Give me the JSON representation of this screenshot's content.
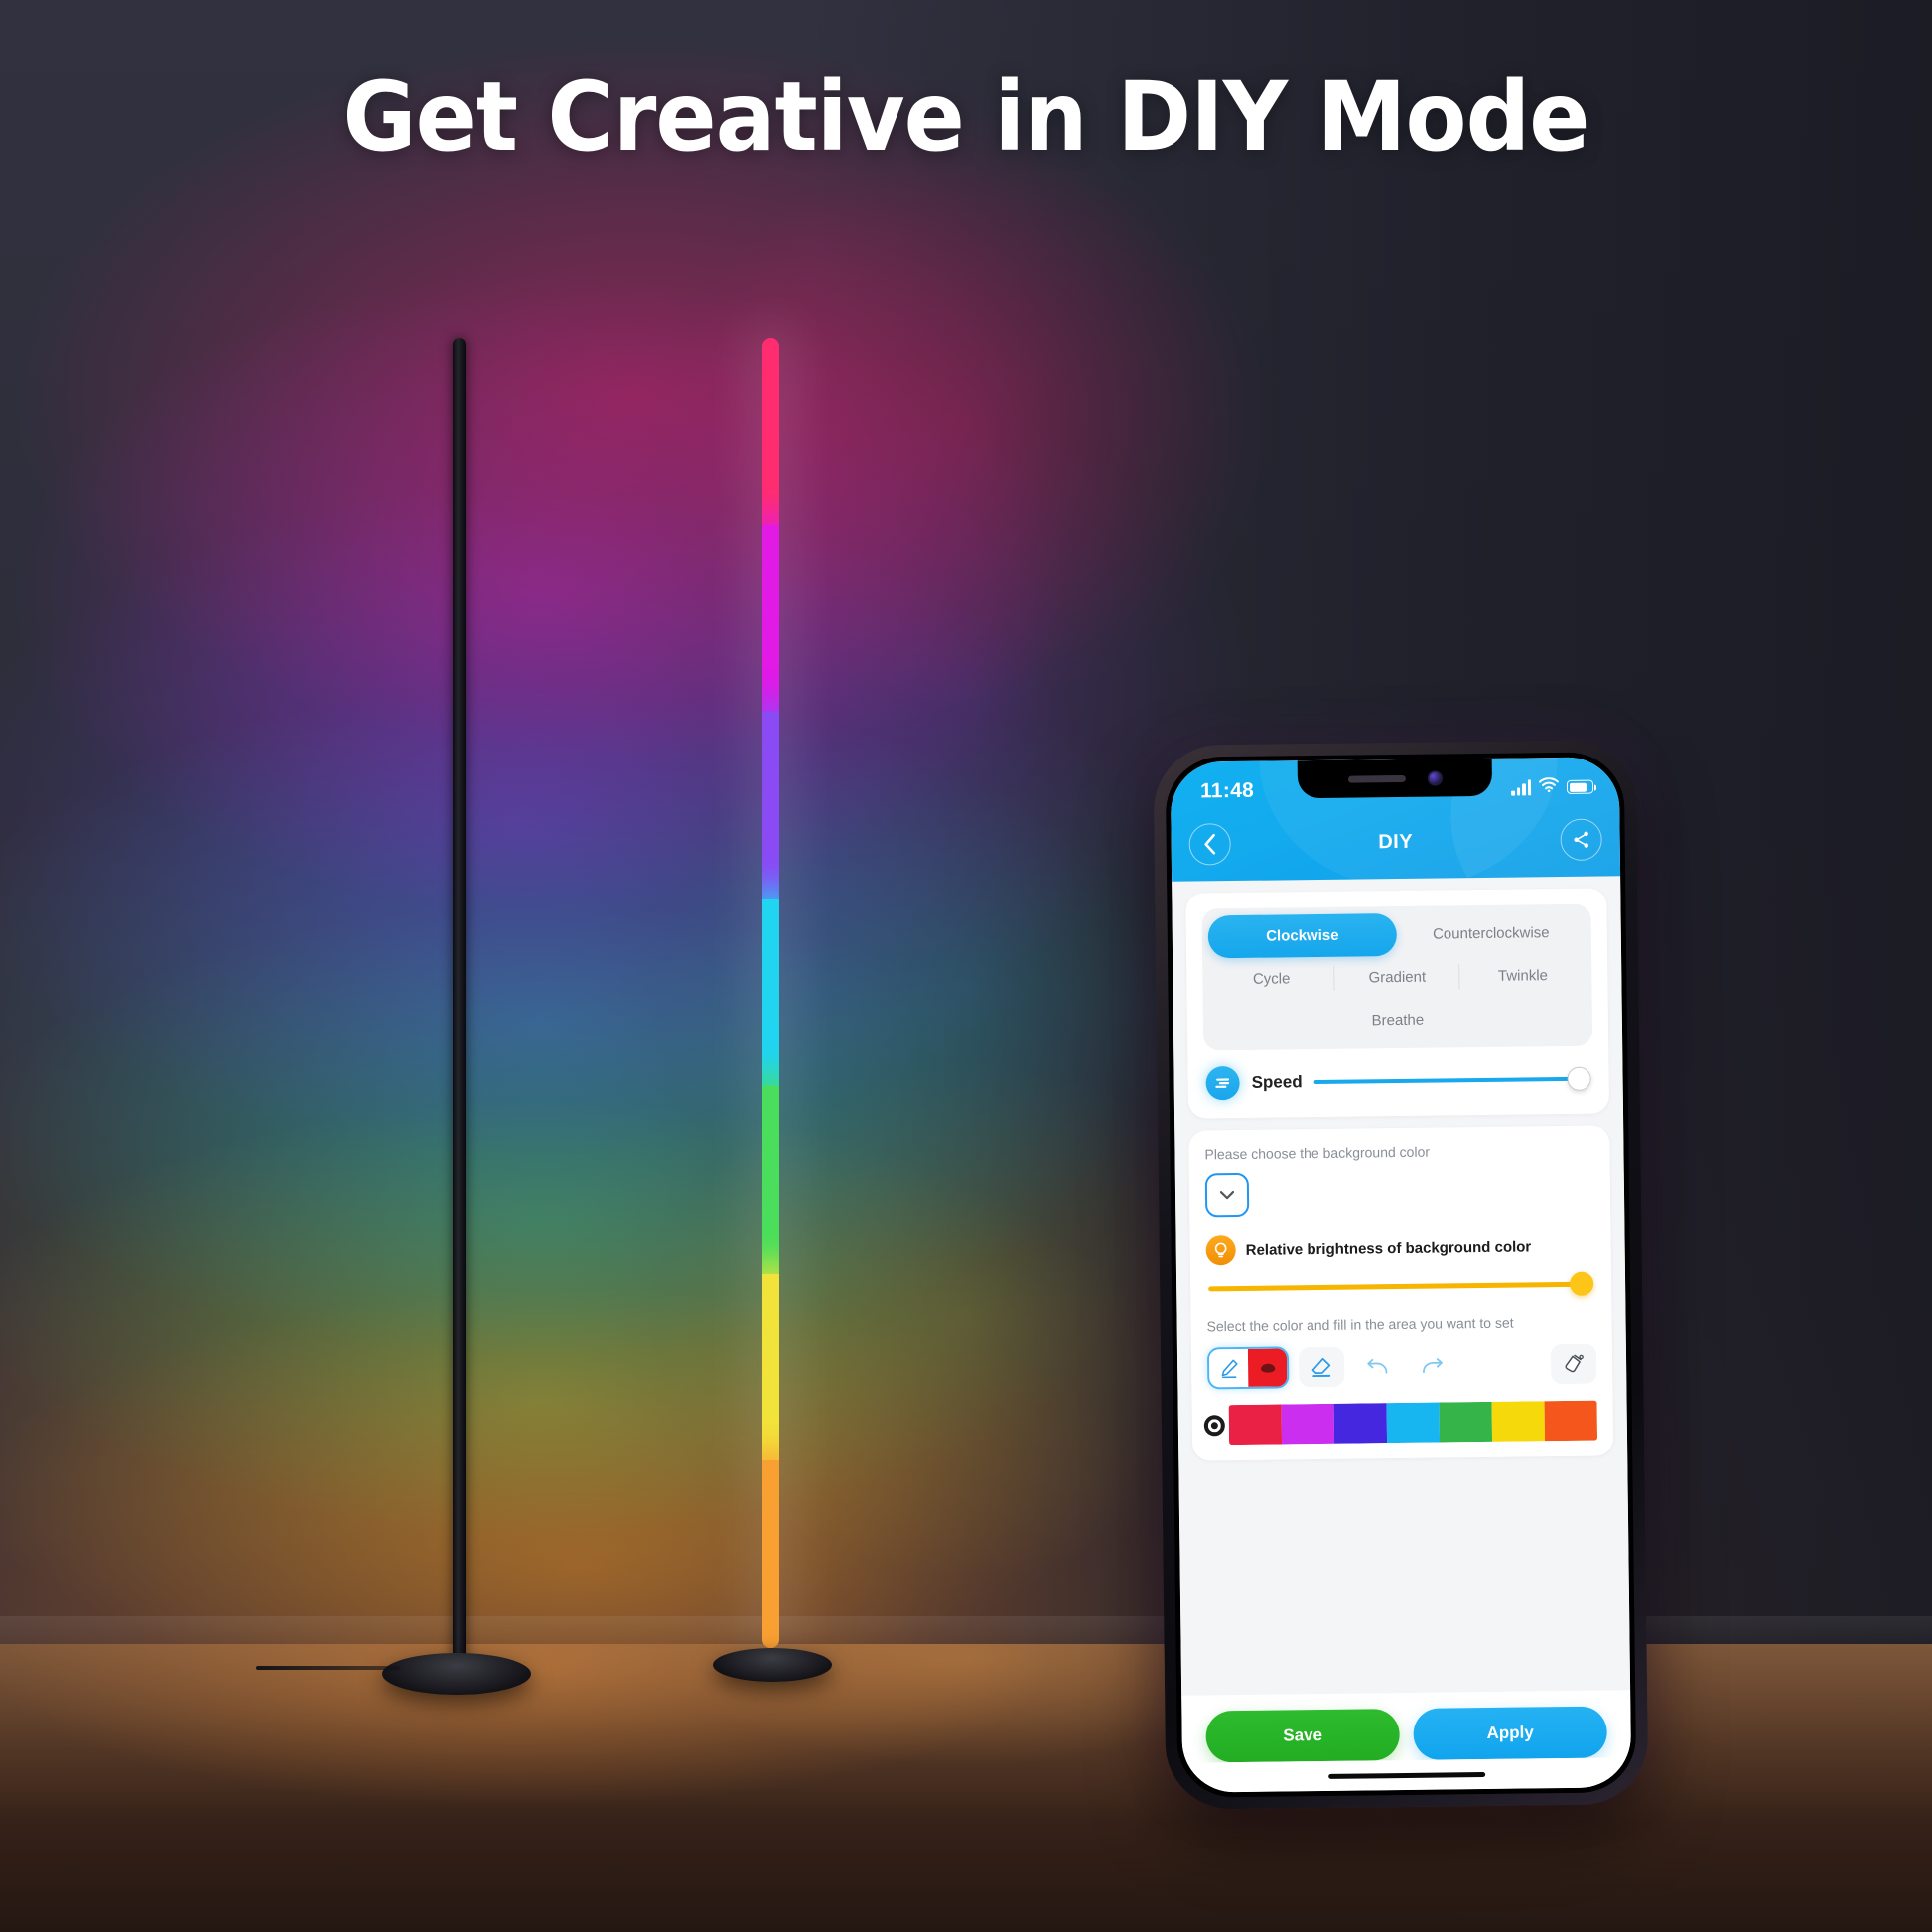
{
  "headline": "Get Creative in DIY Mode",
  "scene": {
    "wall_glow_colors": [
      "#e11e6e",
      "#b928d7",
      "#6946e6",
      "#28aae6",
      "#32c86e",
      "#ebc828",
      "#eb7823"
    ],
    "lamp_right_segments": [
      {
        "name": "rose",
        "color": "#ff2d6f"
      },
      {
        "name": "magenta",
        "color": "#e11ae6"
      },
      {
        "name": "purple",
        "color": "#8a4bf5"
      },
      {
        "name": "cyan",
        "color": "#21d4f0"
      },
      {
        "name": "green",
        "color": "#4ade5c"
      },
      {
        "name": "yellow",
        "color": "#f2e33a"
      },
      {
        "name": "orange",
        "color": "#f9a033"
      }
    ]
  },
  "phone": {
    "status_bar": {
      "time": "11:48",
      "signal_icon": "cellular-signal-icon",
      "wifi_icon": "wifi-icon",
      "battery_icon": "battery-icon"
    },
    "header": {
      "title": "DIY",
      "back_icon": "chevron-left-icon",
      "share_icon": "share-icon",
      "accent_color": "#12b1f0"
    },
    "modes": [
      {
        "label": "Clockwise",
        "selected": true
      },
      {
        "label": "Counterclockwise",
        "selected": false
      },
      {
        "label": "Cycle",
        "selected": false
      },
      {
        "label": "Gradient",
        "selected": false
      },
      {
        "label": "Twinkle",
        "selected": false
      },
      {
        "label": "Breathe",
        "selected": false
      }
    ],
    "speed": {
      "label": "Speed",
      "icon": "speed-icon",
      "value": 100,
      "track_color": "#18a8ee"
    },
    "background_color": {
      "prompt": "Please choose the background color",
      "dropdown_icon": "chevron-down-icon",
      "dropdown_border_color": "#2196f3"
    },
    "brightness": {
      "label": "Relative brightness of background color",
      "icon": "bulb-icon",
      "icon_color": "#f5a01a",
      "value": 100,
      "track_color": "#f7b500"
    },
    "draw": {
      "prompt": "Select the color and fill in the area you want to set",
      "tools": [
        {
          "name": "pen-color-tool",
          "icon": "pen-icon",
          "swatch": "#ec1c24",
          "selected": true
        },
        {
          "name": "eraser-tool",
          "icon": "eraser-icon",
          "selected": false
        },
        {
          "name": "undo-tool",
          "icon": "undo-icon",
          "selected": false
        },
        {
          "name": "redo-tool",
          "icon": "redo-icon",
          "selected": false
        },
        {
          "name": "fill-bucket-tool",
          "icon": "paint-bucket-icon",
          "selected": false
        }
      ],
      "palette": [
        "#ea2045",
        "#cc2ef0",
        "#4627e0",
        "#18b6f0",
        "#35b44a",
        "#f5d90a",
        "#f4561b"
      ],
      "selected_swatch_indicator": "palette-cursor-icon"
    },
    "actions": {
      "save": "Save",
      "apply": "Apply",
      "save_color": "#22ad22",
      "apply_color": "#11a4ed"
    },
    "home_indicator": "home-indicator"
  }
}
